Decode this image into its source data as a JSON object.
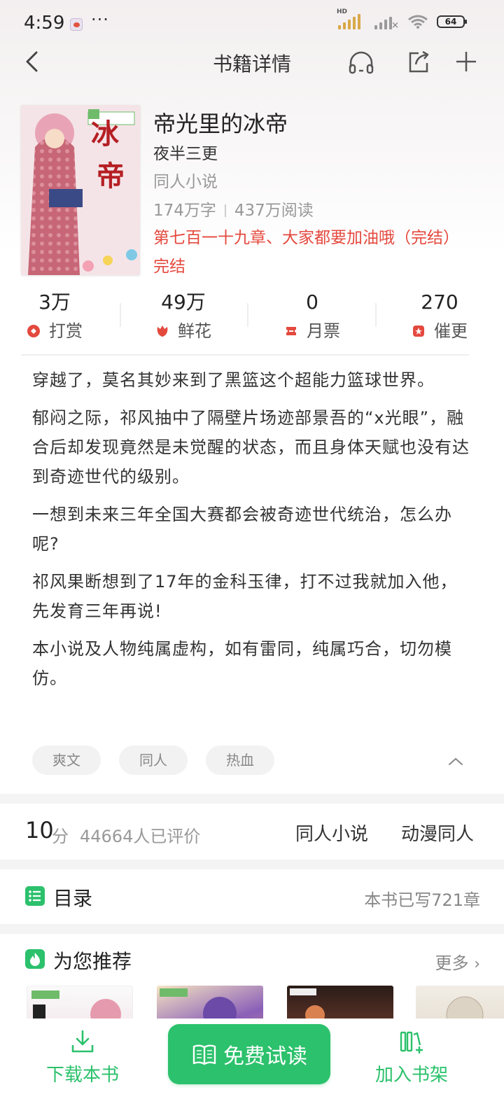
{
  "status_bar": {
    "time": "4:59",
    "dots": "···",
    "hd": "HD",
    "battery": "64"
  },
  "nav": {
    "title": "书籍详情",
    "back_icon": "chevron-left-icon",
    "audio_icon": "headphones-icon",
    "share_icon": "share-icon",
    "add_icon": "plus-icon"
  },
  "book": {
    "title": "帝光里的冰帝",
    "author": "夜半三更",
    "genre": "同人小说",
    "word_count": "174万字",
    "reads": "437万阅读",
    "latest_chapter": "第七百一十九章、大家都要加油哦（完结）",
    "status": "完结",
    "cover_title": "帝光里的冰帝"
  },
  "metrics": [
    {
      "value": "3万",
      "label": "打赏",
      "icon": "reward-icon",
      "color": "#e4493e"
    },
    {
      "value": "49万",
      "label": "鲜花",
      "icon": "flower-icon",
      "color": "#e4493e"
    },
    {
      "value": "0",
      "label": "月票",
      "icon": "ticket-icon",
      "color": "#e4493e"
    },
    {
      "value": "270",
      "label": "催更",
      "icon": "urge-icon",
      "color": "#e4493e"
    }
  ],
  "description": [
    "穿越了，莫名其妙来到了黑篮这个超能力篮球世界。",
    "郁闷之际，祁风抽中了隔壁片场迹部景吾的“x光眼”，融合后却发现竟然是未觉醒的状态，而且身体天赋也没有达到奇迹世代的级别。",
    "一想到未来三年全国大赛都会被奇迹世代统治，怎么办呢?",
    "祁风果断想到了17年的金科玉律，打不过我就加入他，先发育三年再说!",
    "本小说及人物纯属虚构，如有雷同，纯属巧合，切勿模仿。"
  ],
  "tags": [
    "爽文",
    "同人",
    "热血"
  ],
  "rating": {
    "score": "10",
    "unit": "分",
    "rated_count": "44664人已评价",
    "category1": "同人小说",
    "category2": "动漫同人"
  },
  "catalog": {
    "title": "目录",
    "count": "本书已写721章"
  },
  "recommend": {
    "title": "为您推荐",
    "more": "更多"
  },
  "bottom_bar": {
    "download": "下载本书",
    "read_free": "免费试读",
    "add_shelf": "加入书架"
  },
  "colors": {
    "accent": "#2cc16c",
    "red": "#e4493e"
  }
}
